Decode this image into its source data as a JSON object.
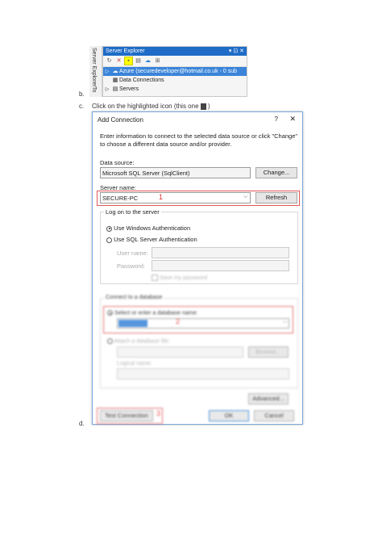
{
  "server_explorer": {
    "vertical_tabs": [
      "Server Explorer",
      "To"
    ],
    "title": "Server Explorer",
    "title_controls": "▾ ⊡ ✕",
    "toolbar_icons": [
      "refresh-icon",
      "stop-icon",
      "connect-to-database-icon",
      "connect-to-server-icon",
      "azure-icon",
      "properties-icon"
    ],
    "tree": [
      {
        "label": "Azure (securedeveloper@hotmail.co.uk - 0 sub",
        "selected": true,
        "icon": "azure-icon"
      },
      {
        "label": "Data Connections",
        "selected": false,
        "icon": "database-icon"
      },
      {
        "label": "Servers",
        "selected": false,
        "icon": "server-icon"
      }
    ]
  },
  "doc": {
    "marker_b": "b.",
    "marker_c": "c.",
    "step_c_text_before": "Click on the highlighted icon (this one",
    "step_c_text_after": ")",
    "marker_d": "d."
  },
  "dialog": {
    "title": "Add Connection",
    "help": "?",
    "close": "✕",
    "description": "Enter information to connect to the selected data source or click \"Change\" to choose a different data source and/or provider.",
    "data_source_label": "Data source:",
    "data_source_value": "Microsoft SQL Server (SqlClient)",
    "change_button": "Change...",
    "server_name_label": "Server name:",
    "server_name_value": "SECURE-PC",
    "server_annotation": "1",
    "refresh_button": "Refresh",
    "logon_group": "Log on to the server",
    "windows_auth": "Use Windows Authentication",
    "sql_auth": "Use SQL Server Authentication",
    "username_label": "User name:",
    "password_label": "Password:",
    "save_password": "Save my password",
    "connect_group": "Connect to a database",
    "select_db": "Select or enter a database name:",
    "db_value": "",
    "db_annotation": "2",
    "attach_db": "Attach a database file:",
    "browse_button": "Browse...",
    "logical_name": "Logical name:",
    "advanced_button": "Advanced...",
    "test_button": "Test Connection",
    "test_annotation": "3",
    "ok_button": "OK",
    "cancel_button": "Cancel"
  }
}
